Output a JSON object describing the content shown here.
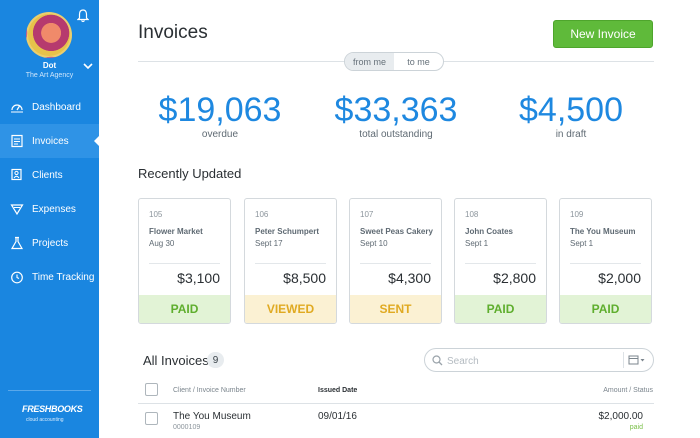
{
  "sidebar": {
    "user_name": "Dot",
    "user_company": "The Art Agency",
    "items": [
      {
        "label": "Dashboard",
        "icon": "dashboard-icon"
      },
      {
        "label": "Invoices",
        "icon": "invoice-icon",
        "active": true
      },
      {
        "label": "Clients",
        "icon": "clients-icon"
      },
      {
        "label": "Expenses",
        "icon": "expenses-icon"
      },
      {
        "label": "Projects",
        "icon": "projects-icon"
      },
      {
        "label": "Time Tracking",
        "icon": "clock-icon"
      }
    ],
    "logo": "FRESHBOOKS",
    "logo_sub": "cloud accounting"
  },
  "header": {
    "title": "Invoices",
    "new_button": "New Invoice",
    "toggle": {
      "from": "from me",
      "to": "to me",
      "selected": "from me"
    }
  },
  "stats": [
    {
      "amount": "$19,063",
      "label": "overdue"
    },
    {
      "amount": "$33,363",
      "label": "total outstanding"
    },
    {
      "amount": "$4,500",
      "label": "in draft"
    }
  ],
  "recent": {
    "title": "Recently Updated",
    "cards": [
      {
        "number": "105",
        "client": "Flower Market",
        "date": "Aug 30",
        "amount": "$3,100",
        "status": "PAID"
      },
      {
        "number": "106",
        "client": "Peter Schumpert",
        "date": "Sept 17",
        "amount": "$8,500",
        "status": "VIEWED"
      },
      {
        "number": "107",
        "client": "Sweet Peas Cakery",
        "date": "Sept 10",
        "amount": "$4,300",
        "status": "SENT"
      },
      {
        "number": "108",
        "client": "John Coates",
        "date": "Sept 1",
        "amount": "$2,800",
        "status": "PAID"
      },
      {
        "number": "109",
        "client": "The You Museum",
        "date": "Sept 1",
        "amount": "$2,000",
        "status": "PAID"
      }
    ]
  },
  "all_invoices": {
    "title": "All Invoices",
    "count": "9",
    "search_placeholder": "Search",
    "columns": {
      "client": "Client / Invoice Number",
      "issued": "Issued Date",
      "amount": "Amount / Status"
    },
    "rows": [
      {
        "client": "The You Museum",
        "number": "0000109",
        "issued": "09/01/16",
        "amount": "$2,000.00",
        "status": "paid"
      }
    ]
  },
  "colors": {
    "sidebar": "#1a86e0",
    "accent": "#1e88e0",
    "new_button": "#5fba3a",
    "paid": "#5fae2e",
    "pending": "#e0aa22"
  }
}
